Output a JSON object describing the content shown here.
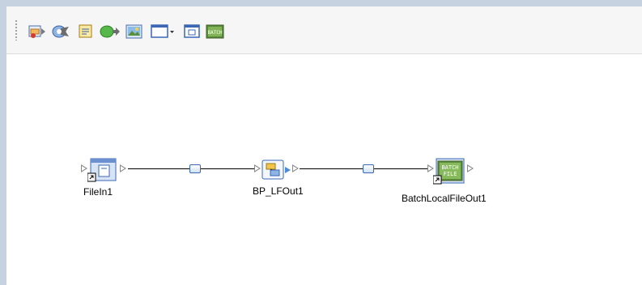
{
  "toolbar": {
    "buttons": [
      {
        "name": "file-adapter-icon"
      },
      {
        "name": "process-icon"
      },
      {
        "name": "document-icon"
      },
      {
        "name": "connector-icon"
      },
      {
        "name": "image-icon"
      },
      {
        "name": "window-dropdown-icon"
      },
      {
        "name": "window-icon"
      },
      {
        "name": "batch-icon",
        "text": "BATCH"
      }
    ]
  },
  "nodes": {
    "filein": {
      "label": "FileIn1"
    },
    "bp": {
      "label": "BP_LFOut1"
    },
    "batch": {
      "label": "BatchLocalFileOut1",
      "icon_text_top": "BATCH",
      "icon_text_bottom": "FILE"
    }
  },
  "colors": {
    "frame": "#c7d2e0",
    "toolbar": "#f6f6f6",
    "connector_blue": "#3b67b5"
  }
}
